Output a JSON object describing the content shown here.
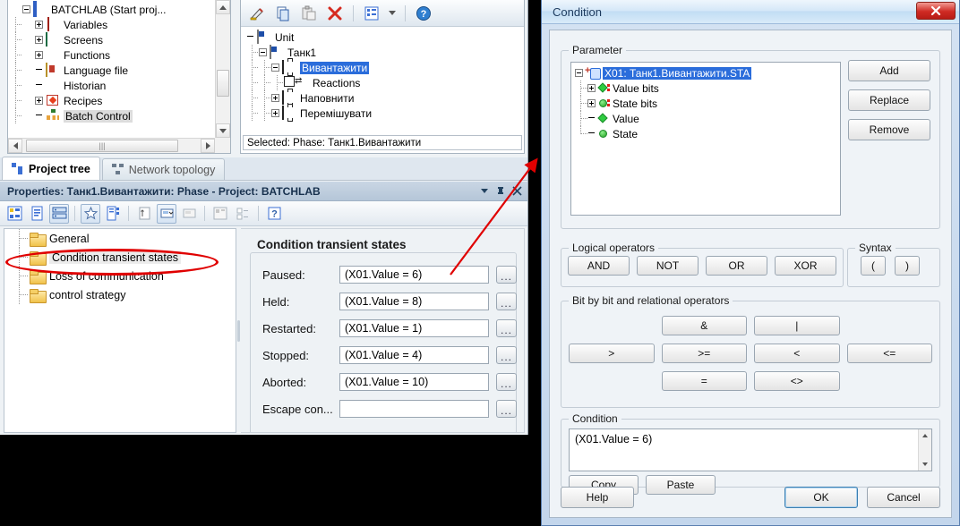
{
  "project_tree": {
    "items": [
      {
        "label": "BATCHLAB (Start proj...",
        "icon": "project-icon",
        "expander": "minus",
        "indent": 0
      },
      {
        "label": "Variables",
        "icon": "variables-icon",
        "expander": "plus",
        "indent": 1
      },
      {
        "label": "Screens",
        "icon": "screens-icon",
        "expander": "plus",
        "indent": 1
      },
      {
        "label": "Functions",
        "icon": "functions-icon",
        "expander": "plus",
        "indent": 1
      },
      {
        "label": "Language file",
        "icon": "language-file-icon",
        "expander": "none",
        "indent": 1
      },
      {
        "label": "Historian",
        "icon": "historian-icon",
        "expander": "none",
        "indent": 1
      },
      {
        "label": "Recipes",
        "icon": "recipes-icon",
        "expander": "plus",
        "indent": 1
      },
      {
        "label": "Batch Control",
        "icon": "batch-control-icon",
        "expander": "none",
        "indent": 1
      }
    ]
  },
  "unit_panel": {
    "toolbar": [
      "edit-pencil-icon",
      "copy-icon",
      "paste-icon",
      "delete-x-icon",
      "tree-view-icon",
      "dropdown-arrow-icon",
      "help-icon"
    ],
    "tree": [
      {
        "label": "Unit",
        "icon": "unit-icon",
        "expander": "none",
        "indent": 0
      },
      {
        "label": "Танк1",
        "icon": "unit-icon",
        "expander": "minus",
        "indent": 1
      },
      {
        "label": "Вивантажити",
        "icon": "phase-icon",
        "expander": "minus",
        "indent": 2,
        "selected": true
      },
      {
        "label": "Reactions",
        "icon": "reactions-icon",
        "expander": "none",
        "indent": 3
      },
      {
        "label": "Наповнити",
        "icon": "phase-icon",
        "expander": "plus",
        "indent": 2
      },
      {
        "label": "Перемішувати",
        "icon": "phase-icon",
        "expander": "plus",
        "indent": 2
      }
    ],
    "status": "Selected: Phase: Танк1.Вивантажити"
  },
  "tabs": [
    {
      "label": "Project tree",
      "icon": "project-tree-icon",
      "active": true
    },
    {
      "label": "Network topology",
      "icon": "network-topology-icon",
      "active": false
    }
  ],
  "properties": {
    "title": "Properties: Танк1.Вивантажити: Phase - Project: BATCHLAB",
    "title_buttons": [
      "dropdown-arrow-icon",
      "pin-icon",
      "close-icon"
    ],
    "folders": [
      {
        "label": "General",
        "selected": false
      },
      {
        "label": "Condition transient states",
        "selected": true
      },
      {
        "label": "Loss of communication",
        "selected": false
      },
      {
        "label": "control strategy",
        "selected": false
      }
    ],
    "group_title": "Condition transient states",
    "fields": [
      {
        "label": "Paused:",
        "value": "(X01.Value = 6)",
        "button": "..."
      },
      {
        "label": "Held:",
        "value": "(X01.Value = 8)",
        "button": "..."
      },
      {
        "label": "Restarted:",
        "value": "(X01.Value = 1)",
        "button": "..."
      },
      {
        "label": "Stopped:",
        "value": "(X01.Value = 4)",
        "button": "..."
      },
      {
        "label": "Aborted:",
        "value": "(X01.Value = 10)",
        "button": "..."
      },
      {
        "label": "Escape con...",
        "value": "",
        "button": "..."
      }
    ]
  },
  "condition_dialog": {
    "title": "Condition",
    "close_label": "✕",
    "parameter": {
      "legend": "Parameter",
      "tree": [
        {
          "label": "X01: Танк1.Вивантажити.STA",
          "icon": "link-icon",
          "expander": "minus",
          "indent": 0,
          "selected": true
        },
        {
          "label": "Value bits",
          "icon": "green-diamond-bits-icon",
          "expander": "plus",
          "indent": 1
        },
        {
          "label": "State bits",
          "icon": "green-circle-bits-icon",
          "expander": "plus",
          "indent": 1
        },
        {
          "label": "Value",
          "icon": "green-diamond-icon",
          "expander": "none",
          "indent": 1
        },
        {
          "label": "State",
          "icon": "green-circle-icon",
          "expander": "none",
          "indent": 1
        }
      ],
      "buttons": [
        "Add",
        "Replace",
        "Remove"
      ]
    },
    "logical_operators": {
      "legend": "Logical operators",
      "buttons": [
        "AND",
        "NOT",
        "OR",
        "XOR"
      ]
    },
    "syntax": {
      "legend": "Syntax",
      "buttons": [
        "(",
        ")"
      ]
    },
    "relational": {
      "legend": "Bit by bit and relational operators",
      "row1": [
        "&",
        "|"
      ],
      "row2": [
        ">",
        ">=",
        "<",
        "<="
      ],
      "row3": [
        "=",
        "<>"
      ]
    },
    "condition": {
      "legend": "Condition",
      "text": "(X01.Value = 6)",
      "buttons": [
        "Copy",
        "Paste"
      ]
    },
    "footer": {
      "help": "Help",
      "ok": "OK",
      "cancel": "Cancel"
    }
  },
  "colors": {
    "selection_blue": "#2b6ddb",
    "annotation_red": "#e00000",
    "close_red": "#cf2a23"
  }
}
